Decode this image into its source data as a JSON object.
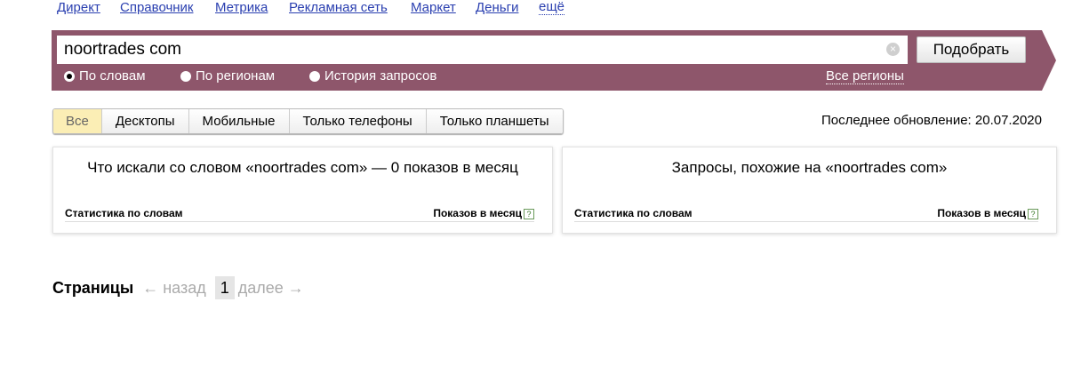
{
  "topnav": [
    "Директ",
    "Справочник",
    "Метрика",
    "Рекламная сеть",
    "Маркет",
    "Деньги",
    "ещё"
  ],
  "search": {
    "value": "noortrades com",
    "button": "Подобрать",
    "regions": "Все регионы",
    "modes": [
      "По словам",
      "По регионам",
      "История запросов"
    ]
  },
  "tabs": [
    "Все",
    "Десктопы",
    "Мобильные",
    "Только телефоны",
    "Только планшеты"
  ],
  "last_update": "Последнее обновление: 20.07.2020",
  "left_panel": {
    "title": "Что искали со словом «noortrades com» — 0 показов в месяц",
    "col1": "Статистика по словам",
    "col2": "Показов в месяц"
  },
  "right_panel": {
    "title": "Запросы, похожие на «noortrades com»",
    "col1": "Статистика по словам",
    "col2": "Показов в месяц"
  },
  "pager": {
    "label": "Страницы",
    "prev": "← назад",
    "current": "1",
    "next": "далее →"
  },
  "colors": {
    "band": "#8e566b",
    "link": "#2a3fb0"
  }
}
